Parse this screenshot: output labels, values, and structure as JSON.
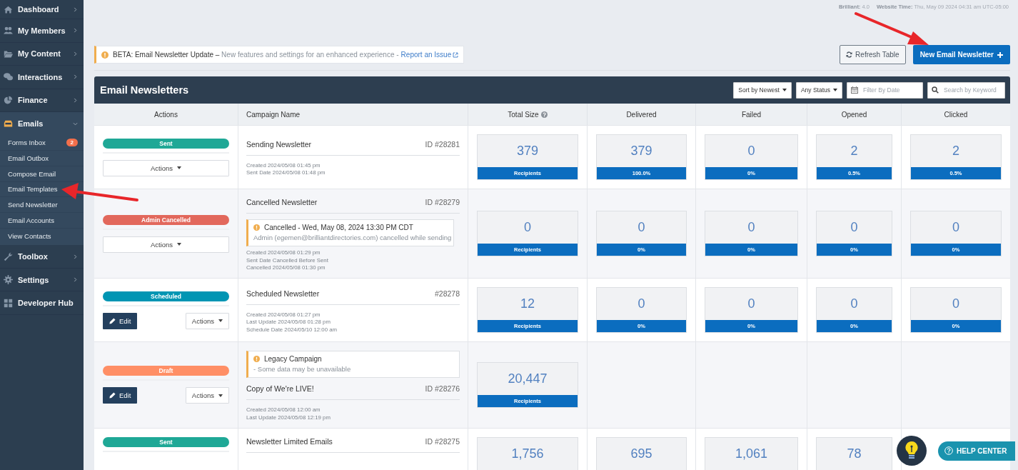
{
  "sidebar": {
    "items": [
      {
        "label": "Dashboard",
        "expanded": false,
        "selected": false
      },
      {
        "label": "My Members",
        "expanded": false,
        "selected": false
      },
      {
        "label": "My Content",
        "expanded": false,
        "selected": false
      },
      {
        "label": "Interactions",
        "expanded": false,
        "selected": false
      },
      {
        "label": "Finance",
        "expanded": false,
        "selected": false
      },
      {
        "label": "Emails",
        "expanded": true,
        "selected": true,
        "children": [
          {
            "label": "Forms Inbox",
            "badge": "2"
          },
          {
            "label": "Email Outbox"
          },
          {
            "label": "Compose Email"
          },
          {
            "label": "Email Templates"
          },
          {
            "label": "Send Newsletter"
          },
          {
            "label": "Email Accounts"
          },
          {
            "label": "View Contacts"
          }
        ]
      },
      {
        "label": "Toolbox",
        "expanded": false,
        "selected": false
      },
      {
        "label": "Settings",
        "expanded": false,
        "selected": false
      },
      {
        "label": "Developer Hub",
        "selected": false
      }
    ]
  },
  "top_info": {
    "version_label": "Brilliant:",
    "version": "4.0",
    "time_label": "Website Time:",
    "time": "Thu, May 09 2024 04:31 am UTC-05:00"
  },
  "notice": {
    "title": "BETA: Email Newsletter Update –",
    "text": "New features and settings for an enhanced experience -",
    "link": "Report an Issue"
  },
  "buttons": {
    "refresh": "Refresh Table",
    "create": "New Email Newsletter"
  },
  "panel": {
    "title": "Email Newsletters",
    "filters": [
      {
        "kind": "dropdown",
        "label": "Sort by Newest"
      },
      {
        "kind": "dropdown",
        "label": "Any Status"
      },
      {
        "kind": "date",
        "placeholder": "Filter By Date"
      },
      {
        "kind": "search",
        "placeholder": "Search by Keyword"
      }
    ]
  },
  "table": {
    "columns": [
      {
        "label": "Actions",
        "help": false
      },
      {
        "label": "Campaign Name",
        "help": false
      },
      {
        "label": "Total Size",
        "help": true
      },
      {
        "label": "Delivered",
        "help": false
      },
      {
        "label": "Failed",
        "help": false
      },
      {
        "label": "Opened",
        "help": false
      },
      {
        "label": "Clicked",
        "help": false
      }
    ],
    "rows": [
      {
        "status": {
          "label": "Sent",
          "color": "#1fa896"
        },
        "actions": "Actions",
        "name": "Sending Newsletter",
        "id": "ID #28281",
        "dates": [
          "Created 2024/05/08 01:45 pm",
          "Sent Date 2024/05/08 01:48 pm"
        ],
        "stats": [
          {
            "value": "379",
            "bar": "Recipients"
          },
          {
            "value": "379",
            "bar": "100.0%"
          },
          {
            "value": "0",
            "bar": "0%"
          },
          {
            "value": "2",
            "bar": "0.5%"
          },
          {
            "value": "2",
            "bar": "0.5%"
          }
        ]
      },
      {
        "status": {
          "label": "Admin Cancelled",
          "color": "#e2685c"
        },
        "actions": "Actions",
        "name": "Cancelled Newsletter",
        "id": "ID #28279",
        "notice": {
          "kind": "trailing",
          "title": "Cancelled - Wed, May 08, 2024 13:30 PM CDT",
          "text": "Admin (egemen@brilliantdirectories.com) cancelled while sending"
        },
        "dates": [
          "Created 2024/05/08 01:29 pm",
          "Sent Date Cancelled Before Sent",
          "Cancelled 2024/05/08 01:30 pm"
        ],
        "stats": [
          {
            "value": "0",
            "bar": "Recipients"
          },
          {
            "value": "0",
            "bar": "0%"
          },
          {
            "value": "0",
            "bar": "0%"
          },
          {
            "value": "0",
            "bar": "0%"
          },
          {
            "value": "0",
            "bar": "0%"
          }
        ]
      },
      {
        "status": {
          "label": "Scheduled",
          "color": "#0095b3"
        },
        "edit": "Edit",
        "actions": "Actions",
        "name": "Scheduled Newsletter",
        "id": "#28278",
        "dates": [
          "Created 2024/05/08 01:27 pm",
          "Last Update 2024/05/08 01:28 pm",
          "Schedule Date 2024/05/10 12:00 am"
        ],
        "stats": [
          {
            "value": "12",
            "bar": "Recipients"
          },
          {
            "value": "0",
            "bar": "0%"
          },
          {
            "value": "0",
            "bar": "0%"
          },
          {
            "value": "0",
            "bar": "0%"
          },
          {
            "value": "0",
            "bar": "0%"
          }
        ]
      },
      {
        "status": {
          "label": "Draft",
          "color": "#ff8f66"
        },
        "edit": "Edit",
        "actions": "Actions",
        "name": "Copy of We're LIVE!",
        "id": "ID #28276",
        "notice": {
          "kind": "leading",
          "title": "Legacy Campaign",
          "text": "- Some data may be unavailable"
        },
        "dates": [
          "Created 2024/05/08 12:00 am",
          "Last Update 2024/05/08 12:19 pm"
        ],
        "stats": [
          {
            "value": "20,447",
            "bar": "Recipients"
          }
        ]
      },
      {
        "status": {
          "label": "Sent",
          "color": "#1fa896"
        },
        "name": "Newsletter Limited Emails",
        "id": "ID #28275",
        "stats": [
          {
            "value": "1,756"
          },
          {
            "value": "695"
          },
          {
            "value": "1,061"
          },
          {
            "value": "78"
          }
        ]
      }
    ]
  },
  "help": {
    "label": "HELP CENTER"
  }
}
